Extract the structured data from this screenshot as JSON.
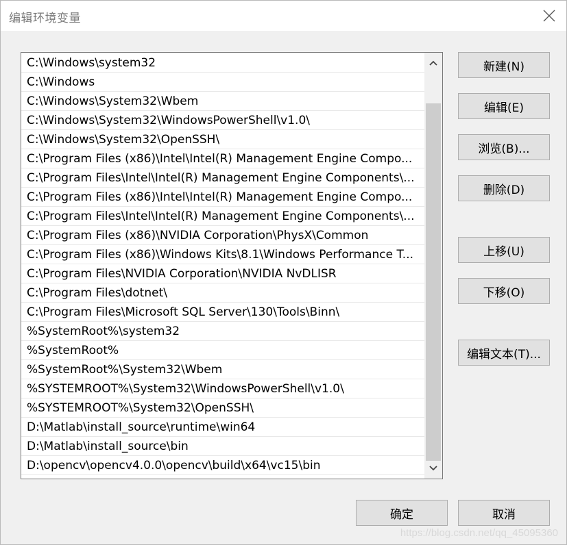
{
  "dialog": {
    "title": "编辑环境变量",
    "close_icon": "close-icon"
  },
  "path_list": {
    "entries": [
      "C:\\Windows\\system32",
      "C:\\Windows",
      "C:\\Windows\\System32\\Wbem",
      "C:\\Windows\\System32\\WindowsPowerShell\\v1.0\\",
      "C:\\Windows\\System32\\OpenSSH\\",
      "C:\\Program Files (x86)\\Intel\\Intel(R) Management Engine Compo...",
      "C:\\Program Files\\Intel\\Intel(R) Management Engine Components\\...",
      "C:\\Program Files (x86)\\Intel\\Intel(R) Management Engine Compo...",
      "C:\\Program Files\\Intel\\Intel(R) Management Engine Components\\...",
      "C:\\Program Files (x86)\\NVIDIA Corporation\\PhysX\\Common",
      "C:\\Program Files (x86)\\Windows Kits\\8.1\\Windows Performance T...",
      "C:\\Program Files\\NVIDIA Corporation\\NVIDIA NvDLISR",
      "C:\\Program Files\\dotnet\\",
      "C:\\Program Files\\Microsoft SQL Server\\130\\Tools\\Binn\\",
      "%SystemRoot%\\system32",
      "%SystemRoot%",
      "%SystemRoot%\\System32\\Wbem",
      "%SYSTEMROOT%\\System32\\WindowsPowerShell\\v1.0\\",
      "%SYSTEMROOT%\\System32\\OpenSSH\\",
      "D:\\Matlab\\install_source\\runtime\\win64",
      "D:\\Matlab\\install_source\\bin",
      "D:\\opencv\\opencv4.0.0\\opencv\\build\\x64\\vc15\\bin"
    ]
  },
  "side_buttons": {
    "new": "新建(N)",
    "edit": "编辑(E)",
    "browse": "浏览(B)...",
    "delete": "删除(D)",
    "move_up": "上移(U)",
    "move_down": "下移(O)",
    "edit_text": "编辑文本(T)..."
  },
  "footer_buttons": {
    "ok": "确定",
    "cancel": "取消"
  },
  "watermark": "https://blog.csdn.net/qq_45095360"
}
